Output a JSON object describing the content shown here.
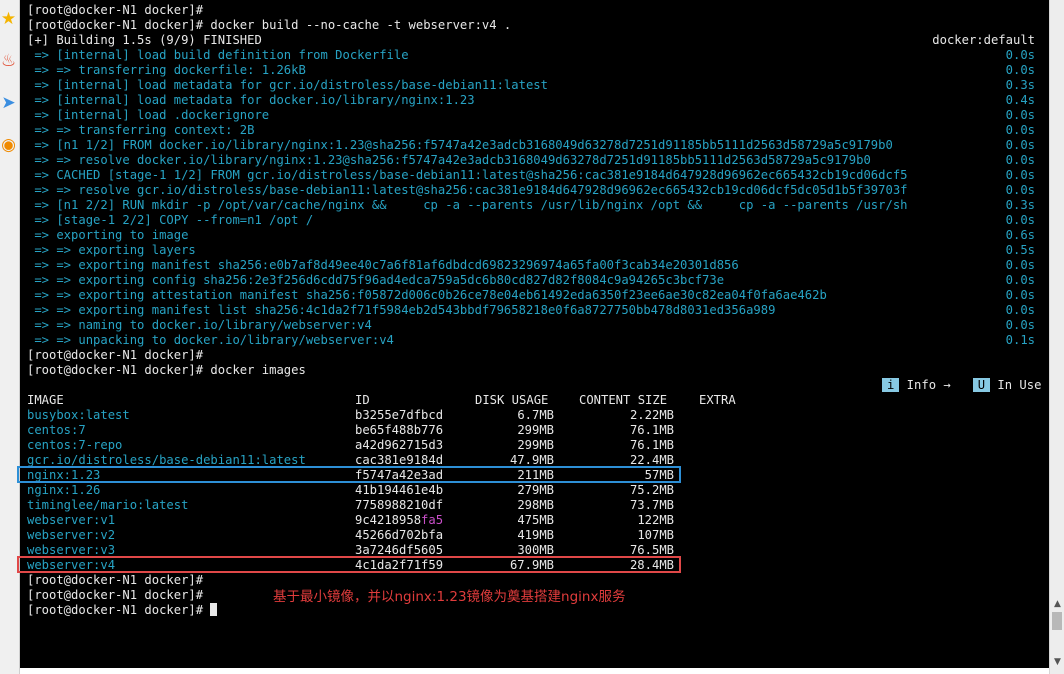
{
  "sidebar": {
    "icons": [
      {
        "name": "star-icon",
        "glyph": "★",
        "color": "#f4b400"
      },
      {
        "name": "app-icon",
        "glyph": "♨",
        "color": "#e04a2f"
      },
      {
        "name": "send-icon",
        "glyph": "➤",
        "color": "#3b8ee0"
      },
      {
        "name": "lifebuoy-icon",
        "glyph": "◉",
        "color": "#f08a00"
      }
    ]
  },
  "build_lines": [
    {
      "text": "[root@docker-N1 docker]#",
      "color": "white"
    },
    {
      "text": "[root@docker-N1 docker]# docker build --no-cache -t webserver:v4 .",
      "color": "white"
    },
    {
      "text": "[+] Building 1.5s (9/9) FINISHED",
      "color": "white",
      "right": "docker:default",
      "right_color": "white"
    },
    {
      "text": " => [internal] load build definition from Dockerfile",
      "color": "cyan",
      "right": "0.0s"
    },
    {
      "text": " => => transferring dockerfile: 1.26kB",
      "color": "cyan",
      "right": "0.0s"
    },
    {
      "text": " => [internal] load metadata for gcr.io/distroless/base-debian11:latest",
      "color": "cyan",
      "right": "0.3s"
    },
    {
      "text": " => [internal] load metadata for docker.io/library/nginx:1.23",
      "color": "cyan",
      "right": "0.4s"
    },
    {
      "text": " => [internal] load .dockerignore",
      "color": "cyan",
      "right": "0.0s"
    },
    {
      "text": " => => transferring context: 2B",
      "color": "cyan",
      "right": "0.0s"
    },
    {
      "text": " => [n1 1/2] FROM docker.io/library/nginx:1.23@sha256:f5747a42e3adcb3168049d63278d7251d91185bb5111d2563d58729a5c9179b0",
      "color": "cyan",
      "right": "0.0s"
    },
    {
      "text": " => => resolve docker.io/library/nginx:1.23@sha256:f5747a42e3adcb3168049d63278d7251d91185bb5111d2563d58729a5c9179b0",
      "color": "cyan",
      "right": "0.0s"
    },
    {
      "text": " => CACHED [stage-1 1/2] FROM gcr.io/distroless/base-debian11:latest@sha256:cac381e9184d647928d96962ec665432cb19cd06dcf5",
      "color": "cyan",
      "right": "0.0s"
    },
    {
      "text": " => => resolve gcr.io/distroless/base-debian11:latest@sha256:cac381e9184d647928d96962ec665432cb19cd06dcf5dc05d1b5f39703f",
      "color": "cyan",
      "right": "0.0s"
    },
    {
      "text": " => [n1 2/2] RUN mkdir -p /opt/var/cache/nginx &&     cp -a --parents /usr/lib/nginx /opt &&     cp -a --parents /usr/sh",
      "color": "cyan",
      "right": "0.3s"
    },
    {
      "text": " => [stage-1 2/2] COPY --from=n1 /opt /",
      "color": "cyan",
      "right": "0.0s"
    },
    {
      "text": " => exporting to image",
      "color": "cyan",
      "right": "0.6s"
    },
    {
      "text": " => => exporting layers",
      "color": "cyan",
      "right": "0.5s"
    },
    {
      "text": " => => exporting manifest sha256:e0b7af8d49ee40c7a6f81af6dbdcd69823296974a65fa00f3cab34e20301d856",
      "color": "cyan",
      "right": "0.0s"
    },
    {
      "text": " => => exporting config sha256:2e3f256d6cdd75f96ad4edca759a5dc6b80cd827d82f8084c9a94265c3bcf73e",
      "color": "cyan",
      "right": "0.0s"
    },
    {
      "text": " => => exporting attestation manifest sha256:f05872d006c0b26ce78e04eb61492eda6350f23ee6ae30c82ea04f0fa6ae462b",
      "color": "cyan",
      "right": "0.0s"
    },
    {
      "text": " => => exporting manifest list sha256:4c1da2f71f5984eb2d543bbdf79658218e0f6a8727750bb478d8031ed356a989",
      "color": "cyan",
      "right": "0.0s"
    },
    {
      "text": " => => naming to docker.io/library/webserver:v4",
      "color": "cyan",
      "right": "0.0s"
    },
    {
      "text": " => => unpacking to docker.io/library/webserver:v4",
      "color": "cyan",
      "right": "0.1s"
    },
    {
      "text": "[root@docker-N1 docker]#",
      "color": "white"
    },
    {
      "text": "[root@docker-N1 docker]# docker images",
      "color": "white"
    }
  ],
  "hint": {
    "info_badge": "i",
    "info_label": " Info →",
    "use_badge": "U",
    "use_label": " In Use"
  },
  "images_table": {
    "headers": {
      "image": "IMAGE",
      "id": "ID",
      "disk": "DISK USAGE",
      "content": "CONTENT SIZE",
      "extra": "EXTRA"
    },
    "rows": [
      {
        "image": "busybox:latest",
        "id": "b3255e7dfbcd",
        "disk": "6.7MB",
        "content": "2.22MB"
      },
      {
        "image": "centos:7",
        "id": "be65f488b776",
        "disk": "299MB",
        "content": "76.1MB"
      },
      {
        "image": "centos:7-repo",
        "id": "a42d962715d3",
        "disk": "299MB",
        "content": "76.1MB"
      },
      {
        "image": "gcr.io/distroless/base-debian11:latest",
        "id": "cac381e9184d",
        "disk": "47.9MB",
        "content": "22.4MB"
      },
      {
        "image": "nginx:1.23",
        "id": "f5747a42e3ad",
        "disk": "211MB",
        "content": "57MB"
      },
      {
        "image": "nginx:1.26",
        "id": "41b194461e4b",
        "disk": "279MB",
        "content": "75.2MB"
      },
      {
        "image": "timinglee/mario:latest",
        "id": "7758988210df",
        "disk": "298MB",
        "content": "73.7MB"
      },
      {
        "image": "webserver:v1",
        "id": "9c4218958",
        "id_highlight": "fa5",
        "disk": "475MB",
        "content": "122MB"
      },
      {
        "image": "webserver:v2",
        "id": "45266d702bfa",
        "disk": "419MB",
        "content": "107MB"
      },
      {
        "image": "webserver:v3",
        "id": "3a7246df5605",
        "disk": "300MB",
        "content": "76.5MB"
      },
      {
        "image": "webserver:v4",
        "id": "4c1da2f71f59",
        "disk": "67.9MB",
        "content": "28.4MB"
      }
    ]
  },
  "trailing_prompts": [
    "[root@docker-N1 docker]#",
    "[root@docker-N1 docker]#",
    "[root@docker-N1 docker]# "
  ],
  "annotation": "基于最小镜像，并以nginx:1.23镜像为奠基搭建nginx服务",
  "colors": {
    "terminal_bg": "#000000",
    "text": "#e8e8e8",
    "cyan": "#27a3c4",
    "highlight_blue": "#2d8fd6",
    "highlight_red": "#e04848",
    "annotation": "#e03c3c",
    "id_magenta": "#c94fc9"
  }
}
